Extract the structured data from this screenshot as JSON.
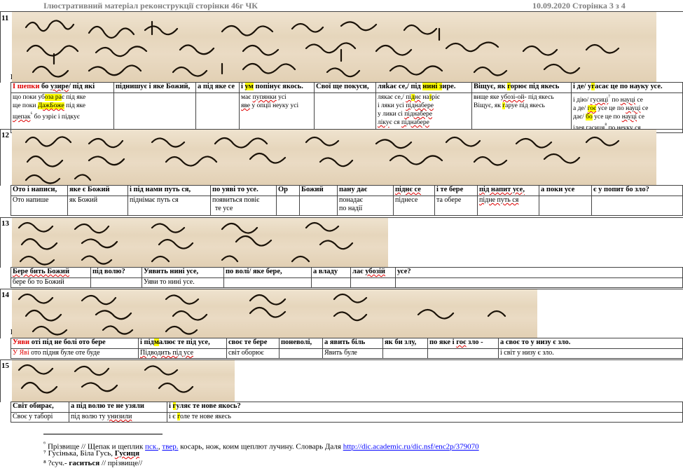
{
  "header": {
    "title": "Ілюстративний матеріал  реконструкції сторінки 46г ЧК",
    "date_page": "10.09.2020  Сторінка 3 з 4"
  },
  "blocks": {
    "b11": {
      "num": "11",
      "mark": "R",
      "row1": [
        "І шепки",
        " бо ",
        "узире",
        "/ під які",
        "піднишує і яке Божий,",
        "а під яке се",
        "і ",
        "ум",
        " попінує якось.",
        "Свої ще покуси,",
        "ляkає се,/ під ",
        "нині з",
        "ире.",
        "Віщує, як ",
        "г",
        "орює під якесь",
        "і де/ у",
        "г",
        "асає це по науку усе."
      ],
      "row2": {
        "c1": [
          "що поки уб",
          "оза ра",
          "є під яке",
          "ще поки ",
          "ДажБоже",
          " під яке",
          "щепак",
          "⁶",
          " бо узріє і підкує"
        ],
        "c2": "",
        "c3": "",
        "c4": [
          "має ",
          "пупянки",
          " усі",
          "яве",
          " у опції неуку усі"
        ],
        "c5": "",
        "c6": [
          "лякає се,/ ",
          "пі",
          "д",
          "нє",
          " на",
          "з",
          "ріє",
          "і ляки усі ",
          "піднабере",
          "у лики сі ",
          "піднабере",
          "ліку",
          "є ся ",
          "піднабере"
        ],
        "c7": [
          "вище яке ",
          "убозі-ой",
          "- під якесь",
          "Віщує, як ",
          "г",
          "аруе під якесь"
        ],
        "c8": [
          "і дію/ ",
          "гусиці",
          "⁷",
          " по ",
          "науці",
          " се",
          "а де/ ",
          "гоє",
          " усе це по ",
          "науці",
          " се",
          "дає/ ",
          "бо",
          " усе це по ",
          "науці",
          " се",
          "ідея ",
          "гасиця",
          "⁸",
          " по неуку ся"
        ]
      }
    },
    "b12": {
      "num": "12",
      "row1": [
        "Ото і написи,",
        "яке є Божий",
        "і під нами путь ся,",
        "по уяві то усе.",
        "Ор",
        "Божий",
        "пану дає",
        "піднє се",
        "і те бере",
        "під напит усе,",
        "а поки усе",
        "є у попит бо зло?"
      ],
      "row2": [
        "Ото напише",
        "як Божий",
        "піднімає путь ся",
        "появиться повіє",
        "те усе",
        "",
        "",
        "понадає",
        "по надії",
        "піднесе",
        "та обере",
        "підне путь ся",
        "",
        ""
      ]
    },
    "b13": {
      "num": "13",
      "row1": [
        "Бере бить Божий",
        "під волю?",
        "Уявить нині усе,",
        "по волі/ яке бере,",
        "а владу",
        "лає ",
        "убозій",
        " усе?"
      ],
      "row2": [
        "бере бо то Божий",
        "",
        "Уяви то нині усе.",
        "",
        "",
        ""
      ]
    },
    "b14": {
      "num": "14",
      "mark": "R",
      "row1": [
        "Уяви",
        " оті під не болі ото бере",
        "і під",
        "м",
        "алює те під усе,",
        "своє те бере",
        "поневолі,",
        "а явить біль",
        "як би злу,",
        "по яке і ",
        "гоє",
        " зло -",
        "а своє то у низу є зло."
      ],
      "row2": [
        "У Яві",
        " ото підня буле оте буде",
        "Підводить під усе",
        "світ оборює",
        "",
        "Явить буле",
        "",
        "",
        "і світ у низу є зло."
      ]
    },
    "b15": {
      "num": "15",
      "row1": [
        "Світ обирає,",
        "а під волю те не узяли",
        "і ",
        "г",
        "уляє те нове якось?"
      ],
      "row2": [
        "Своє у таборі",
        "під волю ту ",
        "унизили",
        "і є ",
        "г",
        "оле те нове якесь"
      ]
    }
  },
  "footnotes": {
    "f6_pre": "⁶",
    "f6_text": " Прізвище // Щепак и щеплик ",
    "f6_l1": "пск.",
    "f6_sep": ", ",
    "f6_l2": "твер.",
    "f6_mid": " косарь, нож, коим щеплют лучину.  Словарь Даля ",
    "f6_url": "http://dic.academic.ru/dic.nsf/enc2p/379070",
    "f7": "⁷ Гусінька, Біла Гусь, ",
    "f7_b": "Гусиця",
    "f8": "⁸ ?суч.- ",
    "f8_b": "гаситься",
    "f8_tail": " // прізвище//"
  },
  "colors": {
    "accent_red": "#e00000",
    "highlight": "#ffff00",
    "link": "#0000ff",
    "header_gray": "#7f7f7f"
  }
}
